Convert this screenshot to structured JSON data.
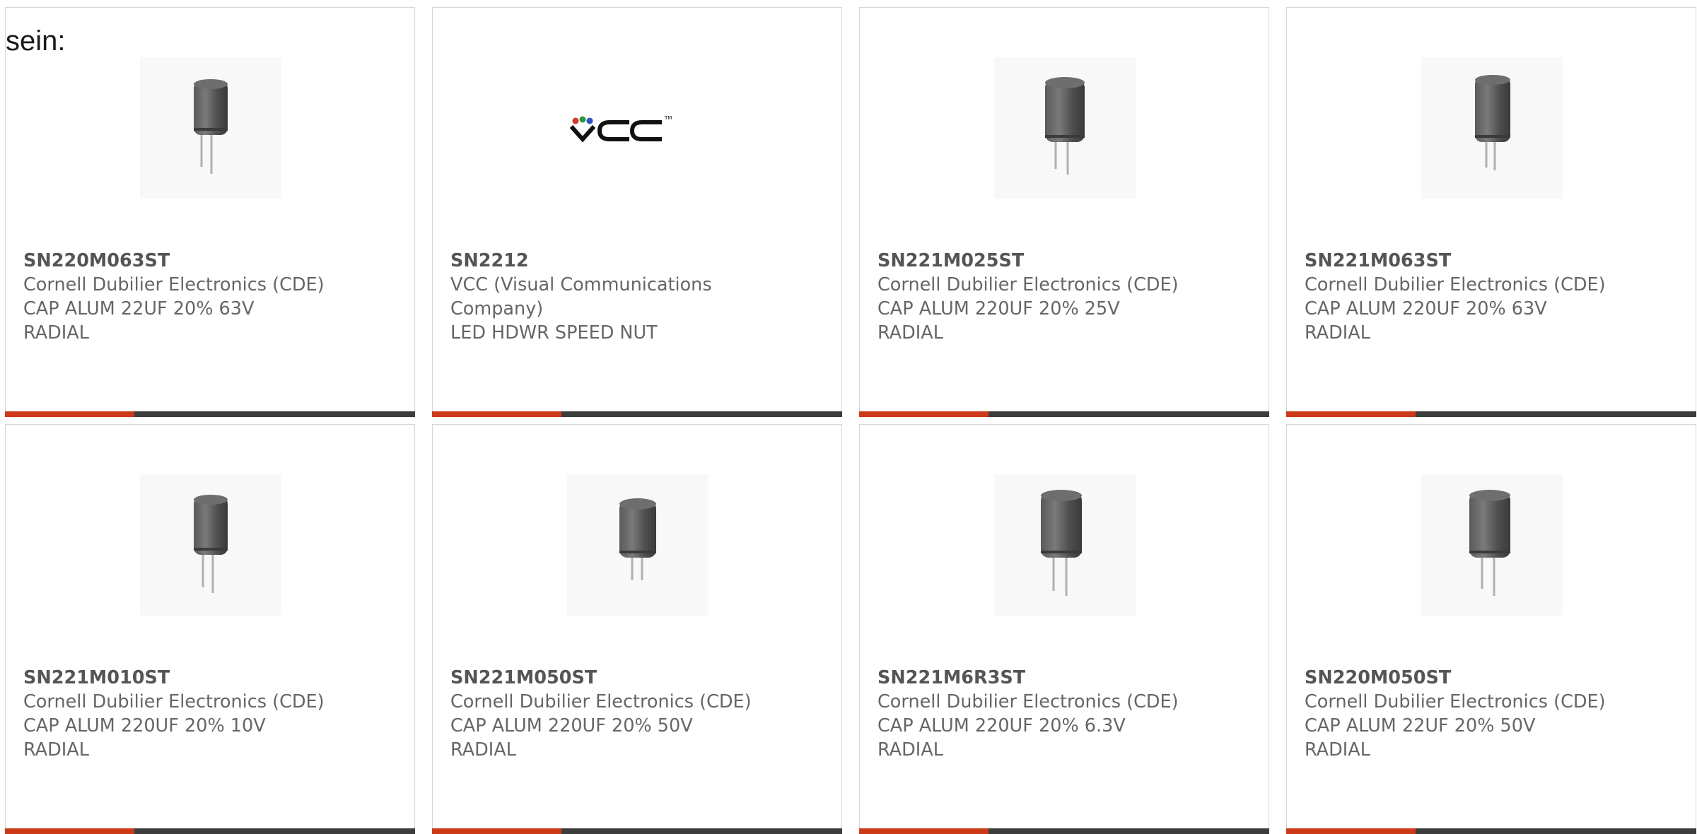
{
  "intro_text": "sein:",
  "colors": {
    "accent": "#cc3a1a",
    "bar_dark": "#3d3d3d",
    "text": "#666666",
    "card_border": "#d6d6d6"
  },
  "cards": [
    {
      "part_number": "SN220M063ST",
      "manufacturer": "Cornell Dubilier Electronics (CDE)",
      "description_line1": "CAP ALUM 22UF 20% 63V",
      "description_line2": "RADIAL",
      "image": "capacitor-icon"
    },
    {
      "part_number": "SN2212",
      "manufacturer": "VCC (Visual Communications Company)",
      "description_line1": "LED HDWR SPEED NUT",
      "description_line2": "",
      "image": "vcc-logo"
    },
    {
      "part_number": "SN221M025ST",
      "manufacturer": "Cornell Dubilier Electronics (CDE)",
      "description_line1": "CAP ALUM 220UF 20% 25V",
      "description_line2": "RADIAL",
      "image": "capacitor-icon"
    },
    {
      "part_number": "SN221M063ST",
      "manufacturer": "Cornell Dubilier Electronics (CDE)",
      "description_line1": "CAP ALUM 220UF 20% 63V",
      "description_line2": "RADIAL",
      "image": "capacitor-icon"
    },
    {
      "part_number": "SN221M010ST",
      "manufacturer": "Cornell Dubilier Electronics (CDE)",
      "description_line1": "CAP ALUM 220UF 20% 10V",
      "description_line2": "RADIAL",
      "image": "capacitor-icon"
    },
    {
      "part_number": "SN221M050ST",
      "manufacturer": "Cornell Dubilier Electronics (CDE)",
      "description_line1": "CAP ALUM 220UF 20% 50V",
      "description_line2": "RADIAL",
      "image": "capacitor-icon"
    },
    {
      "part_number": "SN221M6R3ST",
      "manufacturer": "Cornell Dubilier Electronics (CDE)",
      "description_line1": "CAP ALUM 220UF 20% 6.3V",
      "description_line2": "RADIAL",
      "image": "capacitor-icon"
    },
    {
      "part_number": "SN220M050ST",
      "manufacturer": "Cornell Dubilier Electronics (CDE)",
      "description_line1": "CAP ALUM 22UF 20% 50V",
      "description_line2": "RADIAL",
      "image": "capacitor-icon"
    }
  ]
}
